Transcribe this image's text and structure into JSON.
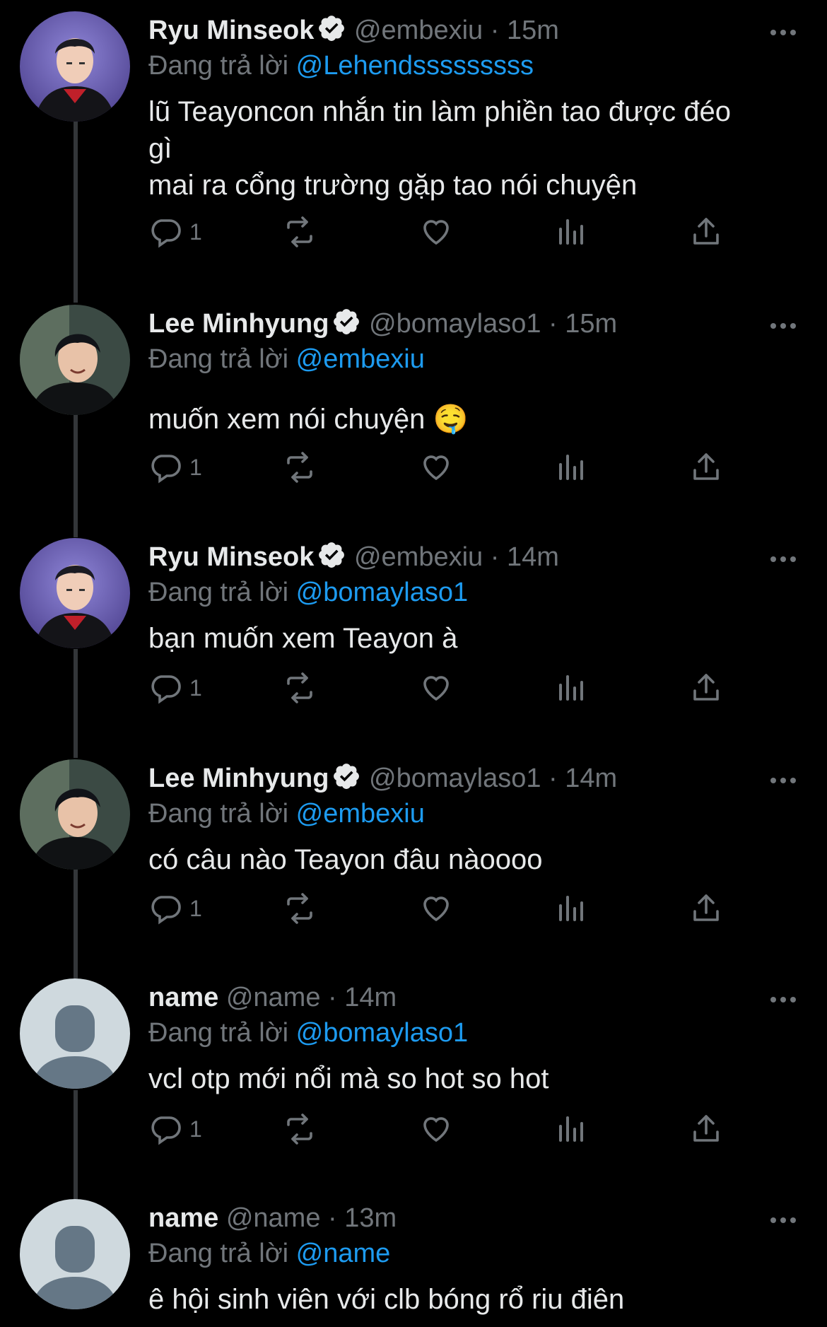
{
  "replying_prefix": "Đang trả lời",
  "tweets": [
    {
      "name": "Ryu Minseok",
      "verified": true,
      "handle": "@embexiu",
      "time": "15m",
      "replying_to": "@Lehendsssssssss",
      "text": "lũ Teayoncon nhắn tin làm phiền tao được đéo\ngì\nmai ra cổng trường gặp tao nói chuyện",
      "reply_count": "1",
      "avatar": "ryu"
    },
    {
      "name": "Lee Minhyung",
      "verified": true,
      "handle": "@bomaylaso1",
      "time": "15m",
      "replying_to": "@embexiu",
      "text": "muốn xem nói chuyện 🤤",
      "reply_count": "1",
      "avatar": "lee"
    },
    {
      "name": "Ryu Minseok",
      "verified": true,
      "handle": "@embexiu",
      "time": "14m",
      "replying_to": "@bomaylaso1",
      "text": "bạn muốn xem Teayon à",
      "reply_count": "1",
      "avatar": "ryu"
    },
    {
      "name": "Lee Minhyung",
      "verified": true,
      "handle": "@bomaylaso1",
      "time": "14m",
      "replying_to": "@embexiu",
      "text": "có câu nào Teayon đâu nàoooo",
      "reply_count": "1",
      "avatar": "lee"
    },
    {
      "name": "name",
      "verified": false,
      "handle": "@name",
      "time": "14m",
      "replying_to": "@bomaylaso1",
      "text": "vcl otp mới nổi mà so hot so hot",
      "reply_count": "1",
      "avatar": "default"
    },
    {
      "name": "name",
      "verified": false,
      "handle": "@name",
      "time": "13m",
      "replying_to": "@name",
      "text": "ê hội sinh viên với clb bóng rổ riu điên",
      "reply_count": "",
      "avatar": "default"
    }
  ],
  "colors": {
    "background": "#000000",
    "text": "#e7e9ea",
    "muted": "#71767b",
    "accent": "#1d9bf0",
    "verified": "#e7e9ea"
  }
}
